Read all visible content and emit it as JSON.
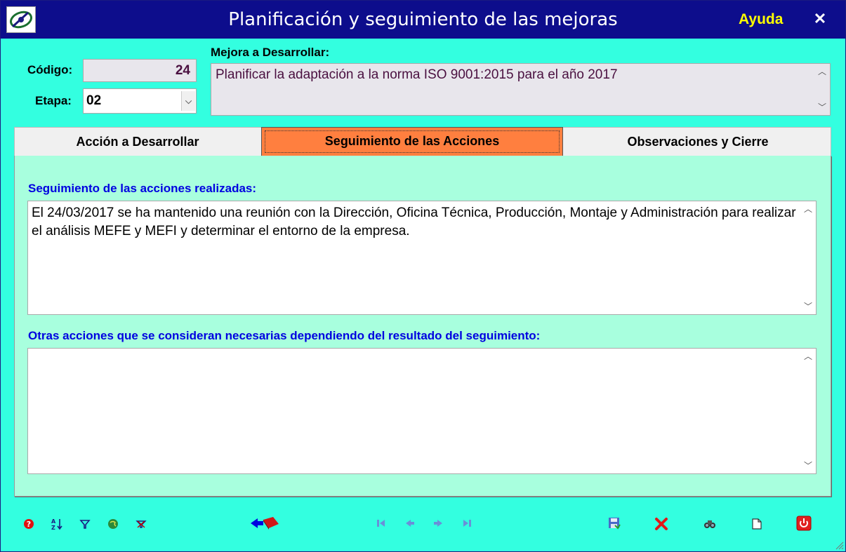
{
  "window": {
    "title": "Planificación y seguimiento de las mejoras",
    "help_label": "Ayuda",
    "close_glyph": "✕"
  },
  "header": {
    "codigo_label": "Código:",
    "codigo_value": "24",
    "etapa_label": "Etapa:",
    "etapa_value": "02",
    "mejora_label": "Mejora a Desarrollar:",
    "mejora_value": "Planificar la adaptación a la norma ISO 9001:2015 para el año 2017"
  },
  "tabs": [
    {
      "label": "Acción a Desarrollar"
    },
    {
      "label": "Seguimiento de las Acciones"
    },
    {
      "label": "Observaciones y Cierre"
    }
  ],
  "active_tab": "Seguimiento de las Acciones",
  "panel": {
    "seguimiento_label": "Seguimiento de las acciones realizadas:",
    "seguimiento_value": "El 24/03/2017 se ha mantenido una reunión con la Dirección, Oficina Técnica, Producción, Montaje y Administración para realizar el análisis MEFE y MEFI y determinar el entorno de la empresa.",
    "otras_label": "Otras acciones que se consideran necesarias dependiendo del resultado del seguimiento:",
    "otras_value": ""
  },
  "toolbar": {
    "left_icons": [
      "help-icon",
      "sort-icon",
      "filter-icon",
      "globe-icon",
      "clear-filter-icon"
    ],
    "center_icons": [
      "back-to-book-icon"
    ],
    "nav_icons": [
      "first-record-icon",
      "previous-record-icon",
      "next-record-icon",
      "last-record-icon"
    ],
    "right_icons": [
      "save-icon",
      "delete-icon",
      "search-icon",
      "new-record-icon",
      "exit-icon"
    ]
  },
  "colors": {
    "titlebar": "#0d0d8c",
    "background": "#33FFE0",
    "panel": "#A8FFDE",
    "active_tab": "#FF7F3F",
    "section_label": "#0000E0",
    "help_link": "#FFFF00"
  }
}
